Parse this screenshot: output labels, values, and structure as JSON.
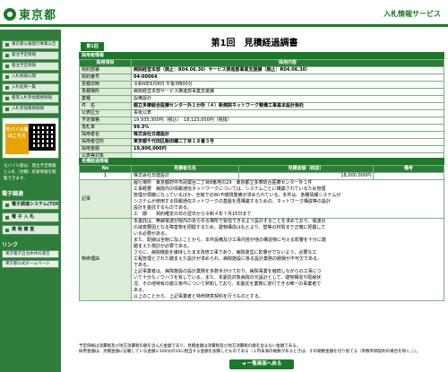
{
  "header": {
    "logo_text": "東京都",
    "site_title": "入札情報サービス"
  },
  "sidebar": {
    "items": [
      "東京都公報発行事業公告",
      "発注予定情報",
      "発注予定情報",
      "入札情報公開",
      "入札結果一覧",
      "都等入札参加資格情報",
      "入札参加資格情報"
    ],
    "mobile": {
      "button": "モバイル版",
      "sub": "はこちら"
    },
    "mobile_note": "モバイル版は、発注予定情報と入札（見積）結果情報を閲覧できます。",
    "section_label": "電子調達",
    "items2": [
      "電子調達システム(TOP)",
      "電 子 入 札",
      "資 格 審 査"
    ],
    "links_label": "リンク",
    "links": [
      "東京電子自治体共同運営",
      "東京都公式ホームページ"
    ]
  },
  "main": {
    "page_title": "第1回　見積経過調書",
    "round_tab": "第1回",
    "info_bar": "採用者情報",
    "columns": [
      "採用項目",
      "採用内容"
    ],
    "rows": [
      {
        "label": "契約部署",
        "value": "病院経営本部（廃止：R04.06.30）サービス推進部事業支援課（廃止：R04.06.30）"
      },
      {
        "label": "契約番号",
        "value": "04-00064"
      },
      {
        "label": "見積日時",
        "value": "令和4年6月8日 午後3時00分"
      },
      {
        "label": "見積場所",
        "value": "病院経営本部サービス推進部事業支援課"
      },
      {
        "label": "業種",
        "value": "設備設計"
      },
      {
        "label": "件　名",
        "value": "都立多摩総合医療センター外１か所（４）新病院ネットワーク整備工事基本設計委託"
      },
      {
        "label": "公表区分",
        "value": "事後公表"
      },
      {
        "label": "予定価格",
        "value": "19,935,300円（税込）　18,123,000円（税抜）"
      },
      {
        "label": "落札率",
        "value": "99.3%"
      },
      {
        "label": "採用者名",
        "value": "株式会社日建設計"
      },
      {
        "label": "採用者住所",
        "value": "東京都千代田区飯田橋二丁目１８番３号"
      },
      {
        "label": "採用金額",
        "value": "19,800,000円"
      },
      {
        "label": "公表等対象",
        "value": ""
      }
    ],
    "bid_bar": "見積経過情報",
    "bid_columns": [
      "No",
      "見積者氏名",
      "見積金額（税抜）",
      "備考"
    ],
    "bids": [
      {
        "no": "1",
        "name": "株式会社日建設計",
        "amount": "18,000,000円",
        "note": ""
      }
    ],
    "memo_label": "記事",
    "memo": "履行場所　東京都府中市武蔵台二丁目8番地の29　東京都立多摩総合医療センター外１件\n工事概要　病院内の情報通信ネットワークについては、システムごとに構築されているため管理\n管理が煩雑になっているほか、全館でのWi-Fi環境整備が求められている。本件は、各種情報システムが\nシステムが使用する情報通信ネットワークの基盤を再構築するための、ネットワーク構成等の設計\n設計を委託するものである。\n工　期　　契約確定の日の翌日から令和４年７月15日まで",
    "reason_label": "特命理由",
    "reason": "本委託は、無線電波が院内のあらゆる場所で受信できるよう設計することを求めており、電波の\nの減衰要因となる障害物を把握するため、建物構造はもとより、壁等の材質まで正確に把握して\nいる必要がある。\nまた、配線は全館に及ぶことから、本件設備及び工事内容が他の構造物に与える影響を十分に踏\n踏まえた検討が必要である。\nさらに、病院機能を維持したまま改修工事であり、病院運営に影響がでないよう、必要な工\n工程管理とされた踏まえた設計が求められ、病院施設に係る設計業務の経験が不可欠である。\nである。\n上記事業者は、病院施設の設計業務を多数手がけており、病院事業を継続しながらの工事につ\nいて十分なノウハウを有している。また、本委託対象病院の元設計として、建物構造や配線状\n況、その他特有の施工条件について熟知しており、本委託を業務に遂行できる唯一の事業者で\nある。\n以上のことから、上記事業者と特命随意契約を行うものとする。"
  },
  "notes": [
    "予定価格は消費税及び地方消費税の額を含んだ金額であり、見積金額は消費税及び地方消費税の額を含まない金額である。",
    "採用金額は、見積金額に記載している金額に100分の10に相当する金額を加算したものである（１円未満の端数があるときは、その端数金額を切り捨てる（単数単価契約の場合を除く。））。"
  ],
  "back_button": "◄ 一覧画面へ戻る"
}
